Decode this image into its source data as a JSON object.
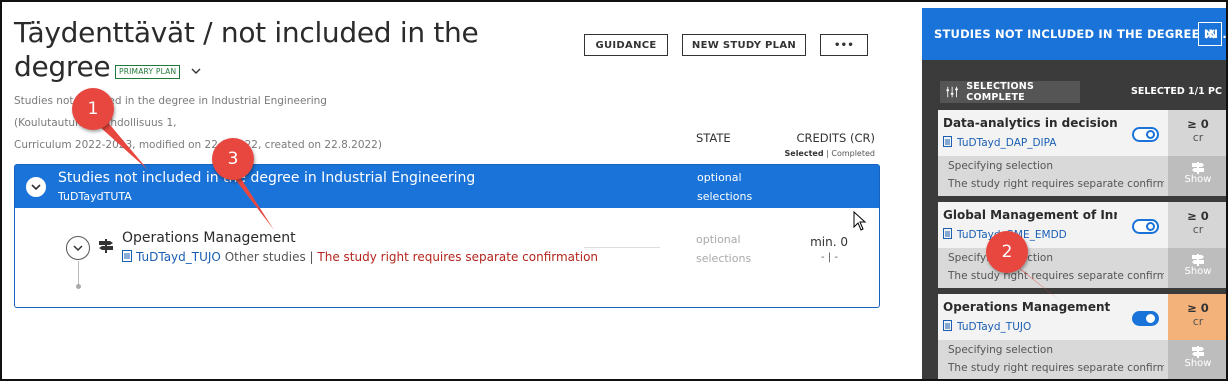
{
  "page": {
    "title": "Täydenttävät / not included in the degree",
    "badge": "PRIMARY PLAN",
    "subtitle_line1": "Studies not included in the degree in Industrial Engineering (Koulutautumismahdollisuus 1,",
    "subtitle_line2": "Curriculum 2022-2023, modified on 22.8.2022, created on 22.8.2022)"
  },
  "toolbar": {
    "guidance_label": "GUIDANCE",
    "new_plan_label": "NEW STUDY PLAN",
    "more_label": "•••"
  },
  "table_header": {
    "state": "STATE",
    "credits": "CREDITS (CR)",
    "selected": "Selected",
    "completed": "Completed"
  },
  "group": {
    "name": "Studies not included in the degree in Industrial Engineering",
    "code": "TuDTaydTUTA",
    "state_line1": "optional",
    "state_line2": "selections"
  },
  "row": {
    "name": "Operations Management",
    "code": "TuDTayd_TUJO",
    "type": " Other studies | ",
    "warning": "The study right requires separate confirmation",
    "state_line1": "optional",
    "state_line2": "selections",
    "credits_min": "min. 0",
    "credits_detail": "- | -"
  },
  "panel": {
    "title": "STUDIES NOT INCLUDED IN THE DEGREE IN ...",
    "selections_button": "SELECTIONS COMPLETE",
    "selected_count": "SELECTED 1/1 PC",
    "cards": [
      {
        "title": "Data-analytics in decision making",
        "code": "TuDTayd_DAP_DIPA",
        "credits": "≥ 0",
        "unit": "cr",
        "spec": "Specifying selection",
        "requirement": "The study right requires separate confirmation",
        "show": "Show",
        "on": false
      },
      {
        "title": "Global Management of Innovation",
        "code": "TuDTayd_GME_EMDD",
        "credits": "≥ 0",
        "unit": "cr",
        "spec": "Specifying selection",
        "requirement": "The study right requires separate confirmation",
        "show": "Show",
        "on": false
      },
      {
        "title": "Operations Management",
        "code": "TuDTayd_TUJO",
        "credits": "≥ 0",
        "unit": "cr",
        "spec": "Specifying selection",
        "requirement": "The study right requires separate confirmation",
        "show": "Show",
        "on": true
      }
    ]
  },
  "callouts": [
    "1",
    "2",
    "3"
  ],
  "colors": {
    "accent": "#1a73d9",
    "warning": "#b3261e",
    "callout": "#e8473f",
    "highlight": "#f3b27a"
  }
}
